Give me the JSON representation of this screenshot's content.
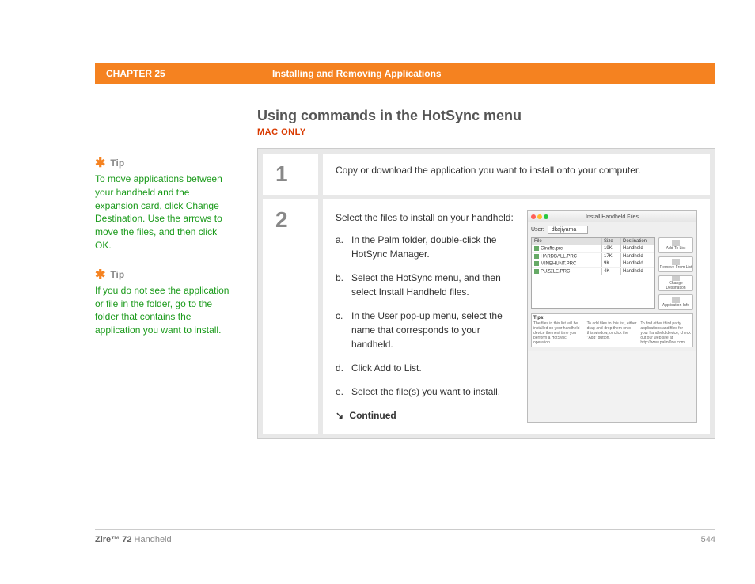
{
  "header": {
    "chapter": "CHAPTER 25",
    "title": "Installing and Removing Applications"
  },
  "section": {
    "title": "Using commands in the HotSync menu",
    "subtitle": "MAC ONLY"
  },
  "tips": [
    {
      "label": "Tip",
      "body": "To move applications between your handheld and the expansion card, click Change Destination. Use the arrows to move the files, and then click OK."
    },
    {
      "label": "Tip",
      "body": "If you do not see the application or file in the folder, go to the folder that contains the application you want to install."
    }
  ],
  "steps": [
    {
      "num": "1",
      "text": "Copy or download the application you want to install onto your computer."
    },
    {
      "num": "2",
      "text": "Select the files to install on your handheld:",
      "substeps": [
        {
          "m": "a.",
          "t": "In the Palm folder, double-click the HotSync Manager."
        },
        {
          "m": "b.",
          "t": "Select the HotSync menu, and then select Install Handheld files."
        },
        {
          "m": "c.",
          "t": "In the User pop-up menu, select the name that corresponds to your handheld."
        },
        {
          "m": "d.",
          "t": "Click Add to List."
        },
        {
          "m": "e.",
          "t": "Select the file(s) you want to install."
        }
      ],
      "continued": "Continued"
    }
  ],
  "dialog": {
    "title": "Install Handheld Files",
    "user_label": "User:",
    "user_value": "dkajiyama",
    "cols": {
      "file": "File",
      "size": "Size",
      "dest": "Destination"
    },
    "rows": [
      {
        "file": "Giraffe.prc",
        "size": "19K",
        "dest": "Handheld"
      },
      {
        "file": "HARDBALL.PRC",
        "size": "17K",
        "dest": "Handheld"
      },
      {
        "file": "MINEHUNT.PRC",
        "size": "9K",
        "dest": "Handheld"
      },
      {
        "file": "PUZZLE.PRC",
        "size": "4K",
        "dest": "Handheld"
      }
    ],
    "buttons": [
      "Add To List",
      "Remove From List",
      "Change Destination",
      "Application Info"
    ],
    "tips_label": "Tips:",
    "tips_cols": [
      "The files in this list will be installed on your handheld device the next time you perform a HotSync operation.",
      "To add files to this list, either drag-and-drop them onto this window, or click the \"Add\" button.",
      "To find other third party applications and files for your handheld device, check out our web site at http://www.palmOne.com"
    ]
  },
  "footer": {
    "product_bold": "Zire™ 72",
    "product_rest": " Handheld",
    "page": "544"
  }
}
